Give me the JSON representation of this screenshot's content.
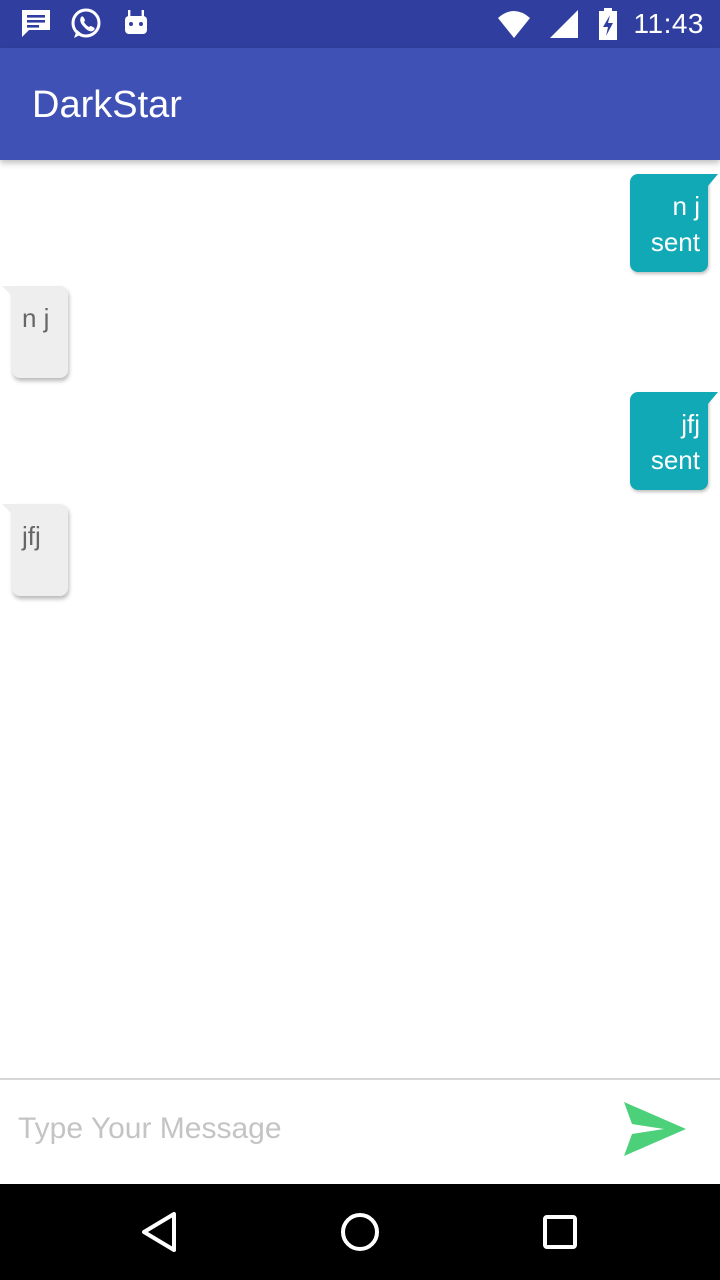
{
  "status_bar": {
    "time": "11:43",
    "icons": [
      "message-notification-icon",
      "whatsapp-icon",
      "android-icon",
      "wifi-icon",
      "signal-icon",
      "battery-charging-icon"
    ]
  },
  "app_bar": {
    "title": "DarkStar",
    "color": "#3F51B5"
  },
  "messages": [
    {
      "direction": "outgoing",
      "text": "n j",
      "status": "sent"
    },
    {
      "direction": "incoming",
      "text": "n j"
    },
    {
      "direction": "outgoing",
      "text": "jfj",
      "status": "sent"
    },
    {
      "direction": "incoming",
      "text": "jfj"
    }
  ],
  "input": {
    "placeholder": "Type Your Message",
    "value": ""
  },
  "send_button": {
    "icon": "send-icon",
    "color": "#4CD07A"
  },
  "nav_bar": {
    "icons": [
      "back-icon",
      "home-icon",
      "recents-icon"
    ]
  },
  "colors": {
    "outgoing_bubble": "#11A9B5",
    "incoming_bubble": "#EEEEEE",
    "status_bar": "#303F9F"
  }
}
